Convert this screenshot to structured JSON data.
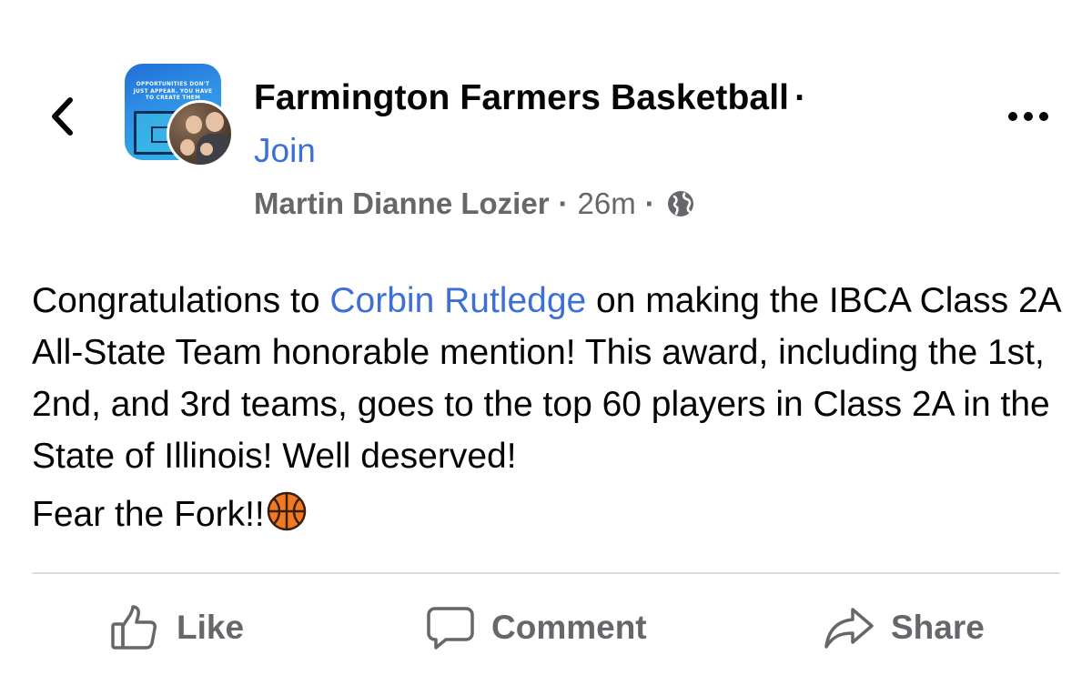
{
  "header": {
    "back_icon": "chevron-left-icon",
    "more_icon": "more-horizontal-icon",
    "group_avatar_text": "OPPORTUNITIES DON'T JUST APPEAR. YOU HAVE TO CREATE THEM",
    "group_name": "Farmington Farmers Basketball",
    "separator": "·",
    "join_label": "Join",
    "author": "Martin Dianne Lozier",
    "timestamp": "26m",
    "privacy_icon": "globe-icon"
  },
  "post": {
    "text_before_mention": "Congratulations to ",
    "mention": "Corbin Rutledge",
    "text_after_mention": " on making the IBCA Class 2A All-State Team honorable mention! This award, including the 1st, 2nd, and 3rd teams, goes to the top 60 players in Class 2A in the State of Illinois! Well deserved!",
    "second_paragraph": "Fear the Fork!!",
    "emoji": "basketball-emoji"
  },
  "actions": {
    "like_label": "Like",
    "comment_label": "Comment",
    "share_label": "Share"
  },
  "colors": {
    "link_blue": "#3e6fd6",
    "meta_gray": "#65676b",
    "text": "#050505",
    "divider": "#dadde1"
  }
}
